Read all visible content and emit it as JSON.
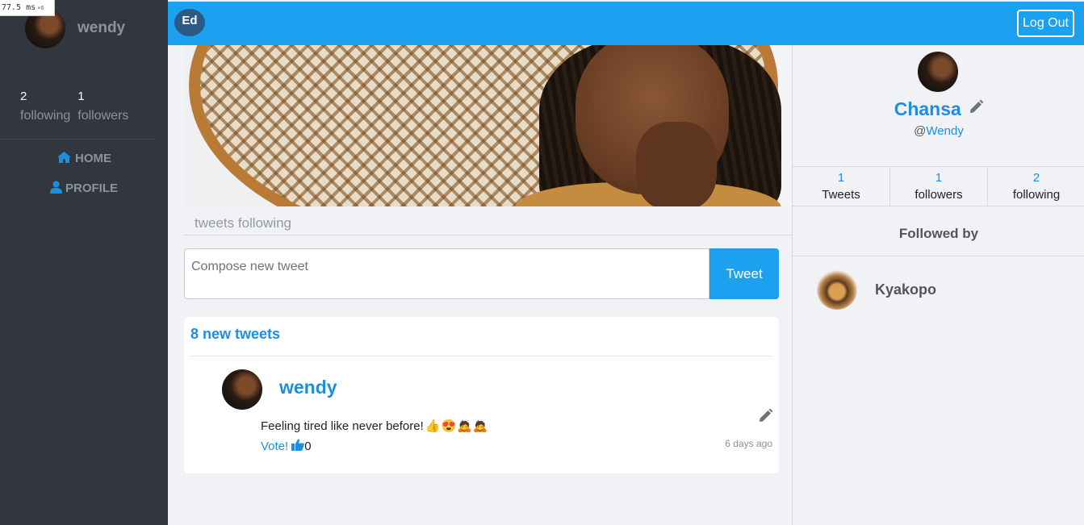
{
  "perf": {
    "time": "77.5",
    "unit": "ms",
    "mult": "×6"
  },
  "sidebar": {
    "username": "wendy",
    "stats": [
      {
        "num": "2",
        "label": "following"
      },
      {
        "num": "1",
        "label": "followers"
      }
    ],
    "nav": [
      {
        "label": "HOME",
        "icon": "home-icon"
      },
      {
        "label": "PROFILE",
        "icon": "user-icon"
      }
    ]
  },
  "topbar": {
    "badge": "Ed",
    "logout": "Log Out",
    "color": "#1ca1f1"
  },
  "feed": {
    "tab_label": "tweets following",
    "compose_placeholder": "Compose new tweet",
    "tweet_button": "Tweet",
    "new_tweets": "8 new tweets",
    "tweets": [
      {
        "user": "wendy",
        "text": "Feeling tired like never before!",
        "emojis": "👍😍🙇🙇",
        "vote_label": "Vote!",
        "votes": "0",
        "time": "6 days ago"
      }
    ]
  },
  "profile": {
    "name": "Chansa",
    "handle_prefix": "@",
    "handle": "Wendy",
    "stats": [
      {
        "num": "1",
        "label": "Tweets"
      },
      {
        "num": "1",
        "label": "followers"
      },
      {
        "num": "2",
        "label": "following"
      }
    ],
    "followed_by_title": "Followed by",
    "followers": [
      {
        "name": "Kyakopo"
      }
    ]
  },
  "colors": {
    "accent": "#1ca1f1",
    "link": "#1c8fdf",
    "sidebar": "#31363f"
  }
}
